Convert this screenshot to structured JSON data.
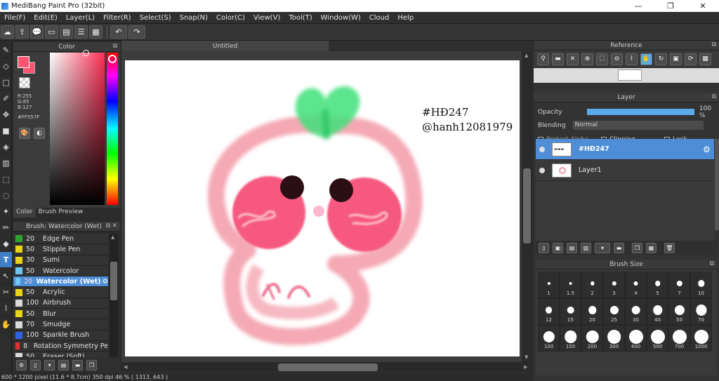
{
  "window": {
    "title": "MediBang Paint Pro (32bit)",
    "minimize": "—",
    "maximize": "❐",
    "close": "✕"
  },
  "menu": [
    "File(F)",
    "Edit(E)",
    "Layer(L)",
    "Filter(R)",
    "Select(S)",
    "Snap(N)",
    "Color(C)",
    "View(V)",
    "Tool(T)",
    "Window(W)",
    "Cloud",
    "Help"
  ],
  "color_panel": {
    "title": "Color",
    "r": "R:255",
    "g": "G:85",
    "b": "B:127",
    "hex": "#FF557F",
    "current_color": "#ff557f"
  },
  "panel_tabs": [
    "Color",
    "Brush Preview"
  ],
  "brush_panel": {
    "title": "Brush: Watercolor (Wet)",
    "brushes": [
      {
        "size": "20",
        "name": "Edge Pen",
        "color": "#2fa12f"
      },
      {
        "size": "50",
        "name": "Stipple Pen",
        "color": "#e8d31a"
      },
      {
        "size": "30",
        "name": "Sumi",
        "color": "#e8d31a"
      },
      {
        "size": "50",
        "name": "Watercolor",
        "color": "#6fc6f0"
      },
      {
        "size": "20",
        "name": "Watercolor (Wet)",
        "color": "#6fc6f0",
        "active": true
      },
      {
        "size": "50",
        "name": "Acrylic",
        "color": "#e8d31a"
      },
      {
        "size": "100",
        "name": "Airbrush",
        "color": "#d9d9d9"
      },
      {
        "size": "50",
        "name": "Blur",
        "color": "#e8d31a"
      },
      {
        "size": "70",
        "name": "Smudge",
        "color": "#d9d9d9"
      },
      {
        "size": "100",
        "name": "Sparkle Brush",
        "color": "#2f63e0"
      },
      {
        "size": "8",
        "name": "Rotation Symmetry Pe",
        "color": "#e03030"
      },
      {
        "size": "50",
        "name": "Eraser (Soft)",
        "color": "#d9d9d9"
      }
    ]
  },
  "canvas": {
    "tab": "Untitled",
    "text_line1": "#HĐ247",
    "text_line2": "@hanh12081979"
  },
  "reference": {
    "title": "Reference"
  },
  "layer_panel": {
    "title": "Layer",
    "opacity_label": "Opacity",
    "opacity_value": "100 %",
    "opacity_fraction": 1.0,
    "blending_label": "Blending",
    "blending_value": "Normal",
    "protect_alpha": "Protect Alpha",
    "clipping": "Clipping",
    "lock": "Lock",
    "layers": [
      {
        "name": "#HĐ247",
        "active": true
      },
      {
        "name": "Layer1",
        "active": false
      }
    ]
  },
  "brush_size": {
    "title": "Brush Size",
    "sizes": [
      "1",
      "1.5",
      "2",
      "3",
      "4",
      "5",
      "7",
      "10",
      "12",
      "15",
      "20",
      "25",
      "30",
      "40",
      "50",
      "70",
      "100",
      "150",
      "200",
      "300",
      "400",
      "500",
      "700",
      "1000"
    ]
  },
  "status": "600 * 1200 pixel   (11.6 * 8.7cm)   350 dpi   46 %   ( 1313, 643 )"
}
